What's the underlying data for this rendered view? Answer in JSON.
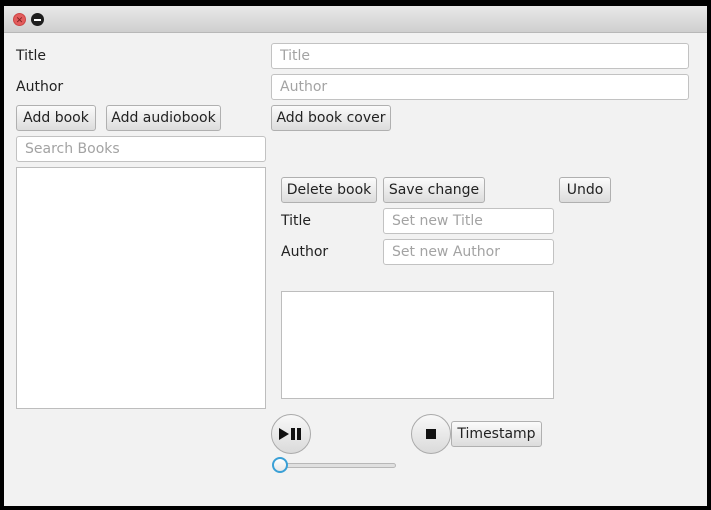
{
  "form": {
    "title_label": "Title",
    "title_placeholder": "Title",
    "author_label": "Author",
    "author_placeholder": "Author",
    "add_book": "Add book",
    "add_audiobook": "Add audiobook",
    "add_book_cover": "Add book cover"
  },
  "search": {
    "placeholder": "Search Books"
  },
  "edit": {
    "delete_book": "Delete book",
    "save_change": "Save change",
    "undo": "Undo",
    "title_label": "Title",
    "title_placeholder": "Set new Title",
    "author_label": "Author",
    "author_placeholder": "Set new Author"
  },
  "player": {
    "play_pause_icon": "play-pause-icon",
    "stop_icon": "stop-icon",
    "timestamp": "Timestamp",
    "progress": 0,
    "accent_color": "#3aa0d6"
  }
}
